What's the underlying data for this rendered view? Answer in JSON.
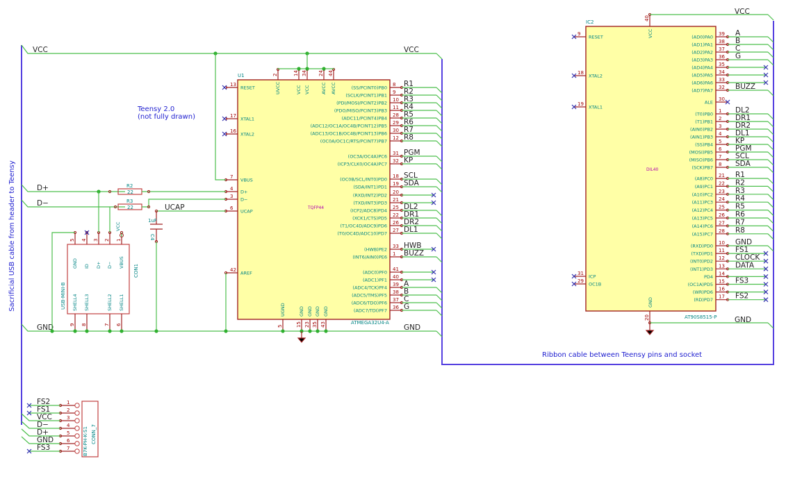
{
  "notes": {
    "usb_cable": "Sacrificial USB cable from header to Teensy",
    "teensy_line1": "Teensy 2.0",
    "teensy_line2": "(not fully drawn)",
    "ribbon": "Ribbon cable between Teensy pins and socket"
  },
  "nets": {
    "vcc": "VCC",
    "gnd": "GND",
    "dplus": "D+",
    "dminus": "D−",
    "ucap": "UCAP"
  },
  "u1": {
    "ref": "U1",
    "value": "ATMEGA32U4-A",
    "package": "TQFP44",
    "left_pins": [
      {
        "num": "13",
        "name": "RESET",
        "nc": true
      },
      {
        "num": "17",
        "name": "XTAL1",
        "nc": true
      },
      {
        "num": "16",
        "name": "XTAL2",
        "nc": true
      },
      {
        "num": "7",
        "name": "VBUS"
      },
      {
        "num": "4",
        "name": "D+"
      },
      {
        "num": "3",
        "name": "D−"
      },
      {
        "num": "6",
        "name": "UCAP"
      },
      {
        "num": "42",
        "name": "AREF"
      }
    ],
    "top_pins": [
      {
        "num": "2",
        "name": "UVCC"
      },
      {
        "num": "14",
        "name": "VCC"
      },
      {
        "num": "34",
        "name": "VCC"
      },
      {
        "num": "24",
        "name": "AVCC"
      },
      {
        "num": "44",
        "name": "AVCC"
      }
    ],
    "bottom_pins": [
      {
        "num": "5",
        "name": "UGND"
      },
      {
        "num": "15",
        "name": "GND"
      },
      {
        "num": "23",
        "name": "GND"
      },
      {
        "num": "35",
        "name": "GND"
      },
      {
        "num": "43",
        "name": "GND"
      }
    ],
    "right_pins": [
      {
        "num": "8",
        "name": "(SS/PCINT0)PB0",
        "net": "R1"
      },
      {
        "num": "9",
        "name": "(SCLK/PCINT1)PB1",
        "net": "R2"
      },
      {
        "num": "10",
        "name": "(PDI/MOSI/PCINT2)PB2",
        "net": "R3"
      },
      {
        "num": "11",
        "name": "(PDO/MISO/PCINT3)PB3",
        "net": "R4"
      },
      {
        "num": "28",
        "name": "(ADC11/PCINT4)PB4",
        "net": "R5"
      },
      {
        "num": "29",
        "name": "(ADC12/OC1A/OC4B/PCINT12)PB5",
        "net": "R6"
      },
      {
        "num": "30",
        "name": "(ADC13/OC1B/OC4B/PCINT13)PB6",
        "net": "R7"
      },
      {
        "num": "12",
        "name": "(OC0A/OC1C/RTS/PCINT7)PB7",
        "net": "R8"
      },
      {
        "num": "31",
        "name": "(OC3A/OC4A)PC6",
        "net": "PGM"
      },
      {
        "num": "32",
        "name": "(ICP3/CLK0/OC4A)PC7",
        "net": "KP"
      },
      {
        "num": "18",
        "name": "(OC0B/SCL/INT0)PD0",
        "net": "SCL"
      },
      {
        "num": "19",
        "name": "(SDA/INT1)PD1",
        "net": "SDA"
      },
      {
        "num": "20",
        "name": "(RXD/INT2)PD2",
        "net": "",
        "nc": true
      },
      {
        "num": "21",
        "name": "(TXD/INT3)PD3",
        "net": "",
        "nc": true
      },
      {
        "num": "25",
        "name": "(ICP2/ADC8)PD4",
        "net": "DL2"
      },
      {
        "num": "22",
        "name": "(XCK1/CTS)PD5",
        "net": "DR1"
      },
      {
        "num": "26",
        "name": "(T1/OC4D/ADC9)PD6",
        "net": "DR2"
      },
      {
        "num": "27",
        "name": "(T0/OC4D/ADC10)PD7",
        "net": "DL1"
      },
      {
        "num": "33",
        "name": "(HWB)PE2",
        "net": "HWB",
        "nc": true
      },
      {
        "num": "1",
        "name": "(INT6/AIN0)PE6",
        "net": "BUZZ"
      },
      {
        "num": "41",
        "name": "(ADC0)PF0",
        "net": "",
        "nc": true
      },
      {
        "num": "40",
        "name": "(ADC1)PF1",
        "net": "",
        "nc": true
      },
      {
        "num": "39",
        "name": "(ADC4/TCK)PF4",
        "net": "A"
      },
      {
        "num": "38",
        "name": "(ADC5/TMS)PF5",
        "net": "B"
      },
      {
        "num": "37",
        "name": "(ADC6/TDO)PF6",
        "net": "C"
      },
      {
        "num": "36",
        "name": "(ADC7/TDI)PF7",
        "net": "G"
      }
    ]
  },
  "ic2": {
    "ref": "IC2",
    "value": "AT90S8515-P",
    "package": "DIL40",
    "top_pin": {
      "num": "40",
      "name": "VCC"
    },
    "bottom_pin": {
      "num": "20",
      "name": "GND"
    },
    "left_pins": [
      {
        "num": "9",
        "name": "RESET"
      },
      {
        "num": "18",
        "name": "XTAL2"
      },
      {
        "num": "19",
        "name": "XTAL1"
      },
      {
        "num": "31",
        "name": "ICP"
      },
      {
        "num": "29",
        "name": "OC1B"
      }
    ],
    "right_pins": [
      {
        "num": "39",
        "name": "(AD0)PA0",
        "net": "A"
      },
      {
        "num": "38",
        "name": "(AD1)PA1",
        "net": "B"
      },
      {
        "num": "37",
        "name": "(AD2)PA2",
        "net": "C"
      },
      {
        "num": "36",
        "name": "(AD3)PA3",
        "net": "G"
      },
      {
        "num": "35",
        "name": "(AD4)PA4",
        "net": "",
        "nc": true
      },
      {
        "num": "34",
        "name": "(AD5)PA5",
        "net": "",
        "nc": true
      },
      {
        "num": "33",
        "name": "(AD6)PA6",
        "net": "",
        "nc": true
      },
      {
        "num": "32",
        "name": "(AD7)PA7",
        "net": "BUZZ"
      },
      {
        "num": "30",
        "name": "ALE",
        "net": "",
        "stub": true
      },
      {
        "num": "1",
        "name": "(T0)PB0",
        "net": "DL2"
      },
      {
        "num": "2",
        "name": "(T1)PB1",
        "net": "DR1"
      },
      {
        "num": "3",
        "name": "(AIN0)PB2",
        "net": "DR2"
      },
      {
        "num": "4",
        "name": "(AIN1)PB3",
        "net": "DL1"
      },
      {
        "num": "5",
        "name": "(SS)PB4",
        "net": "KP"
      },
      {
        "num": "6",
        "name": "(MOSI)PB5",
        "net": "PGM"
      },
      {
        "num": "7",
        "name": "(MISO)PB6",
        "net": "SCL"
      },
      {
        "num": "8",
        "name": "(SCK)PB7",
        "net": "SDA"
      },
      {
        "num": "21",
        "name": "(A8)PC0",
        "net": "R1"
      },
      {
        "num": "22",
        "name": "(A9)PC1",
        "net": "R2"
      },
      {
        "num": "23",
        "name": "(A10)PC2",
        "net": "R3"
      },
      {
        "num": "24",
        "name": "(A11)PC3",
        "net": "R4"
      },
      {
        "num": "25",
        "name": "(A12)PC4",
        "net": "R5"
      },
      {
        "num": "26",
        "name": "(A13)PC5",
        "net": "R6"
      },
      {
        "num": "27",
        "name": "(A14)PC6",
        "net": "R7"
      },
      {
        "num": "28",
        "name": "(A15)PC7",
        "net": "R8"
      },
      {
        "num": "10",
        "name": "(RXD)PD0",
        "net": "GND"
      },
      {
        "num": "11",
        "name": "(TXD)PD1",
        "net": "FS1",
        "nc": true
      },
      {
        "num": "12",
        "name": "(INT0)PD2",
        "net": "CLOCK",
        "nc": true
      },
      {
        "num": "13",
        "name": "(INT1)PD3",
        "net": "DATA",
        "nc": true
      },
      {
        "num": "14",
        "name": "PD4",
        "net": "",
        "nc": true
      },
      {
        "num": "15",
        "name": "(OC1A)PD5",
        "net": "FS3",
        "nc": true
      },
      {
        "num": "16",
        "name": "(WR)PD6",
        "net": "",
        "nc": true
      },
      {
        "num": "17",
        "name": "(RD)PD7",
        "net": "FS2",
        "nc": true
      }
    ]
  },
  "r2": {
    "ref": "R2",
    "value": "22"
  },
  "r3": {
    "ref": "R3",
    "value": "22"
  },
  "c4": {
    "ref": "C4",
    "value": "1uF"
  },
  "con1": {
    "ref": "CON1",
    "value": "USB-MINI-B",
    "vcc_label": "VCC",
    "top_pins": [
      {
        "num": "5",
        "name": "GND"
      },
      {
        "num": "4",
        "name": "ID"
      },
      {
        "num": "3",
        "name": "D+"
      },
      {
        "num": "2",
        "name": "D−"
      },
      {
        "num": "1",
        "name": "VBUS"
      }
    ],
    "bottom_pins": [
      {
        "num": "9",
        "name": "SHELL4"
      },
      {
        "num": "8",
        "name": "SHELL3"
      },
      {
        "num": "7",
        "name": "SHELL2"
      },
      {
        "num": "6",
        "name": "SHELL1"
      }
    ]
  },
  "conn7": {
    "ref": "CONN_7",
    "value": "B7K-PH-K-S1",
    "pins": [
      {
        "num": "1",
        "net": "FS2",
        "nc": true
      },
      {
        "num": "2",
        "net": "FS1",
        "nc": true
      },
      {
        "num": "3",
        "net": "VCC"
      },
      {
        "num": "4",
        "net": "D−"
      },
      {
        "num": "5",
        "net": "D+"
      },
      {
        "num": "6",
        "net": "GND"
      },
      {
        "num": "7",
        "net": "FS3",
        "nc": true
      }
    ]
  }
}
